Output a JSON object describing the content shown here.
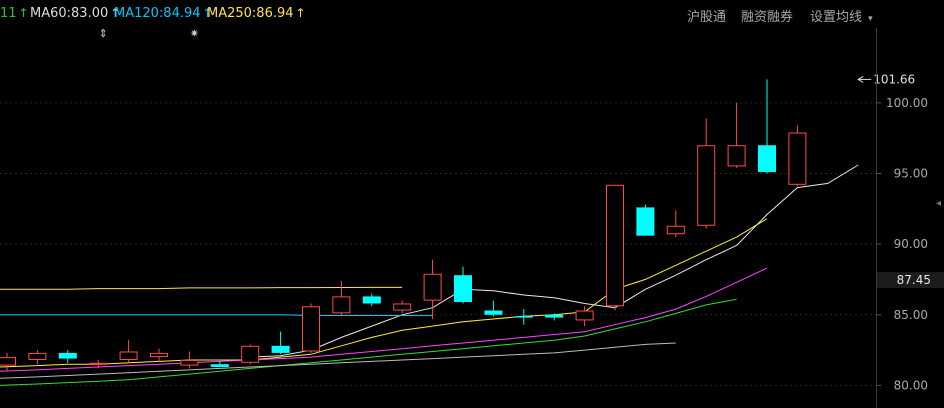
{
  "toolbar": {
    "ma_labels": [
      {
        "text": "11",
        "arrow": "↑",
        "color": "#22cc22"
      },
      {
        "text": "MA60:83.00",
        "arrow": "↑",
        "color": "#dddddd"
      },
      {
        "text": "MA120:84.94",
        "arrow": "↑",
        "color": "#00c8ff"
      },
      {
        "text": "MA250:86.94",
        "arrow": "↑",
        "color": "#ffe14d"
      }
    ],
    "buttons": [
      "沪股通",
      "融资融券",
      "设置均线"
    ],
    "dropdown_glyph": "▾"
  },
  "chart_data": {
    "type": "candlestick",
    "y_axis_ticks": [
      100.0,
      95.0,
      90.0,
      85.0,
      80.0
    ],
    "y_axis_ticks_text": [
      "100.00",
      "95.00",
      "90.00",
      "85.00",
      "80.00"
    ],
    "ylim": [
      78.4,
      105.3
    ],
    "current_price": 87.45,
    "current_price_text": "87.45",
    "max_annotation": {
      "value": 101.66,
      "text": "101.66",
      "candle_index": 28
    },
    "markers": [
      {
        "candle_index": 3,
        "glyph": "⇕"
      },
      {
        "candle_index": 6,
        "glyph": "✷"
      }
    ],
    "candles": [
      {
        "o": 81.4,
        "h": 82.3,
        "l": 81.0,
        "c": 82.0
      },
      {
        "o": 81.8,
        "h": 82.5,
        "l": 81.5,
        "c": 82.3
      },
      {
        "o": 82.3,
        "h": 82.5,
        "l": 81.6,
        "c": 81.9
      },
      {
        "o": 81.5,
        "h": 81.8,
        "l": 81.2,
        "c": 81.6
      },
      {
        "o": 81.8,
        "h": 83.2,
        "l": 81.6,
        "c": 82.4
      },
      {
        "o": 82.0,
        "h": 82.6,
        "l": 81.7,
        "c": 82.3
      },
      {
        "o": 81.4,
        "h": 82.4,
        "l": 81.2,
        "c": 81.8
      },
      {
        "o": 81.5,
        "h": 81.7,
        "l": 81.3,
        "c": 81.3
      },
      {
        "o": 81.6,
        "h": 82.9,
        "l": 81.5,
        "c": 82.8
      },
      {
        "o": 82.8,
        "h": 83.8,
        "l": 82.2,
        "c": 82.3
      },
      {
        "o": 82.4,
        "h": 85.8,
        "l": 82.3,
        "c": 85.6
      },
      {
        "o": 85.1,
        "h": 87.4,
        "l": 84.9,
        "c": 86.3
      },
      {
        "o": 86.3,
        "h": 86.5,
        "l": 85.6,
        "c": 85.8
      },
      {
        "o": 85.3,
        "h": 86.0,
        "l": 85.1,
        "c": 85.8
      },
      {
        "o": 86.0,
        "h": 88.9,
        "l": 84.7,
        "c": 87.9
      },
      {
        "o": 87.8,
        "h": 88.4,
        "l": 85.8,
        "c": 85.9
      },
      {
        "o": 85.3,
        "h": 86.0,
        "l": 84.9,
        "c": 85.0
      },
      {
        "o": 84.9,
        "h": 85.4,
        "l": 84.3,
        "c": 84.8
      },
      {
        "o": 85.0,
        "h": 85.1,
        "l": 84.6,
        "c": 84.8
      },
      {
        "o": 84.6,
        "h": 85.6,
        "l": 84.2,
        "c": 85.3
      },
      {
        "o": 85.6,
        "h": 94.2,
        "l": 85.3,
        "c": 94.2
      },
      {
        "o": 92.6,
        "h": 92.8,
        "l": 90.6,
        "c": 90.6
      },
      {
        "o": 90.7,
        "h": 92.4,
        "l": 90.5,
        "c": 91.3
      },
      {
        "o": 91.3,
        "h": 98.9,
        "l": 91.1,
        "c": 97.0
      },
      {
        "o": 95.5,
        "h": 100.0,
        "l": 95.4,
        "c": 97.0
      },
      {
        "o": 97.0,
        "h": 101.66,
        "l": 95.0,
        "c": 95.1
      },
      {
        "o": 94.2,
        "h": 98.4,
        "l": 94.1,
        "c": 97.9
      }
    ],
    "ma_lines": [
      {
        "name": "MA5",
        "color": "#e8e8e8",
        "start_index": 8,
        "values": [
          82.0,
          82.1,
          82.5,
          83.4,
          84.2,
          85.0,
          85.5,
          86.8,
          86.7,
          86.4,
          86.2,
          85.8,
          85.5,
          86.8,
          87.8,
          88.9,
          89.9,
          92.1,
          94.0,
          94.3,
          95.6
        ]
      },
      {
        "name": "MA10",
        "color": "#ffee33",
        "start_index": 0,
        "values": [
          81.3,
          81.4,
          81.5,
          81.5,
          81.6,
          81.7,
          81.8,
          81.8,
          81.8,
          82.0,
          82.2,
          82.8,
          83.4,
          83.9,
          84.2,
          84.5,
          84.7,
          84.9,
          85.0,
          85.2,
          86.8,
          87.5,
          88.5,
          89.5,
          90.5,
          91.8
        ]
      },
      {
        "name": "MA20",
        "color": "#ff44ff",
        "start_index": 0,
        "values": [
          81.0,
          81.1,
          81.2,
          81.3,
          81.4,
          81.5,
          81.6,
          81.7,
          81.8,
          81.9,
          82.0,
          82.2,
          82.4,
          82.6,
          82.8,
          83.0,
          83.2,
          83.4,
          83.6,
          83.8,
          84.3,
          84.8,
          85.4,
          86.3,
          87.3,
          88.3
        ]
      },
      {
        "name": "MA30",
        "color": "#33dd33",
        "start_index": 0,
        "values": [
          80.0,
          80.1,
          80.2,
          80.3,
          80.4,
          80.6,
          80.8,
          81.0,
          81.2,
          81.4,
          81.6,
          81.8,
          82.0,
          82.2,
          82.4,
          82.6,
          82.8,
          83.0,
          83.2,
          83.5,
          84.0,
          84.5,
          85.1,
          85.7,
          86.1
        ]
      },
      {
        "name": "MA60",
        "color": "#bbbbbb",
        "start_index": 0,
        "values": [
          80.5,
          80.6,
          80.7,
          80.8,
          80.9,
          81.0,
          81.1,
          81.2,
          81.3,
          81.4,
          81.5,
          81.6,
          81.7,
          81.8,
          81.9,
          82.0,
          82.1,
          82.2,
          82.3,
          82.5,
          82.7,
          82.9,
          83.0
        ]
      },
      {
        "name": "MA120",
        "color": "#00c8ff",
        "start_index": 0,
        "values": [
          85.0,
          85.0,
          85.0,
          85.0,
          85.0,
          85.0,
          85.0,
          85.0,
          85.0,
          85.0,
          84.95,
          84.95,
          84.95,
          84.95,
          84.94
        ]
      },
      {
        "name": "MA250",
        "color": "#ffe14d",
        "start_index": 0,
        "values": [
          86.8,
          86.8,
          86.8,
          86.85,
          86.85,
          86.85,
          86.9,
          86.9,
          86.9,
          86.92,
          86.92,
          86.93,
          86.94,
          86.94
        ]
      }
    ]
  }
}
